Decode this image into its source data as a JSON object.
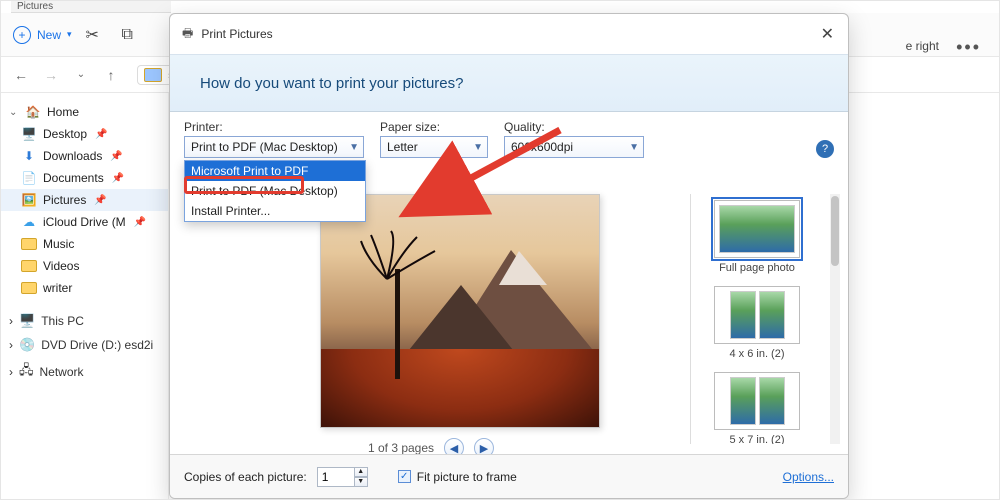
{
  "explorer": {
    "tab_title": "Pictures",
    "new_label": "New",
    "right_hint": "e right",
    "address_icon": "picture-folder-icon",
    "tree": {
      "home": "Home",
      "items": [
        {
          "label": "Desktop",
          "icon": "desktop"
        },
        {
          "label": "Downloads",
          "icon": "downloads"
        },
        {
          "label": "Documents",
          "icon": "documents"
        },
        {
          "label": "Pictures",
          "icon": "pictures",
          "selected": true
        },
        {
          "label": "iCloud Drive (M",
          "icon": "icloud"
        },
        {
          "label": "Music",
          "icon": "music"
        },
        {
          "label": "Videos",
          "icon": "videos"
        },
        {
          "label": "writer",
          "icon": "folder"
        }
      ],
      "groups": [
        {
          "label": "This PC",
          "icon": "monitor"
        },
        {
          "label": "DVD Drive (D:) esd2i",
          "icon": "disc"
        },
        {
          "label": "Network",
          "icon": "network"
        }
      ]
    }
  },
  "dialog": {
    "title": "Print Pictures",
    "heading": "How do you want to print your pictures?",
    "labels": {
      "printer": "Printer:",
      "paper": "Paper size:",
      "quality": "Quality:"
    },
    "printer_selected": "Print to PDF (Mac Desktop)",
    "printer_options": [
      "Microsoft Print to PDF",
      "Print to PDF (Mac Desktop)",
      "Install Printer..."
    ],
    "paper_selected": "Letter",
    "quality_selected": "600x600dpi",
    "pager": "1 of 3 pages",
    "layouts": [
      {
        "label": "Full page photo",
        "cols": 1,
        "selected": true
      },
      {
        "label": "4 x 6 in. (2)",
        "cols": 2
      },
      {
        "label": "5 x 7 in. (2)",
        "cols": 2
      }
    ],
    "footer": {
      "copies_label": "Copies of each picture:",
      "copies_value": "1",
      "fit_label": "Fit picture to frame",
      "fit_checked": true,
      "options_link": "Options..."
    }
  }
}
